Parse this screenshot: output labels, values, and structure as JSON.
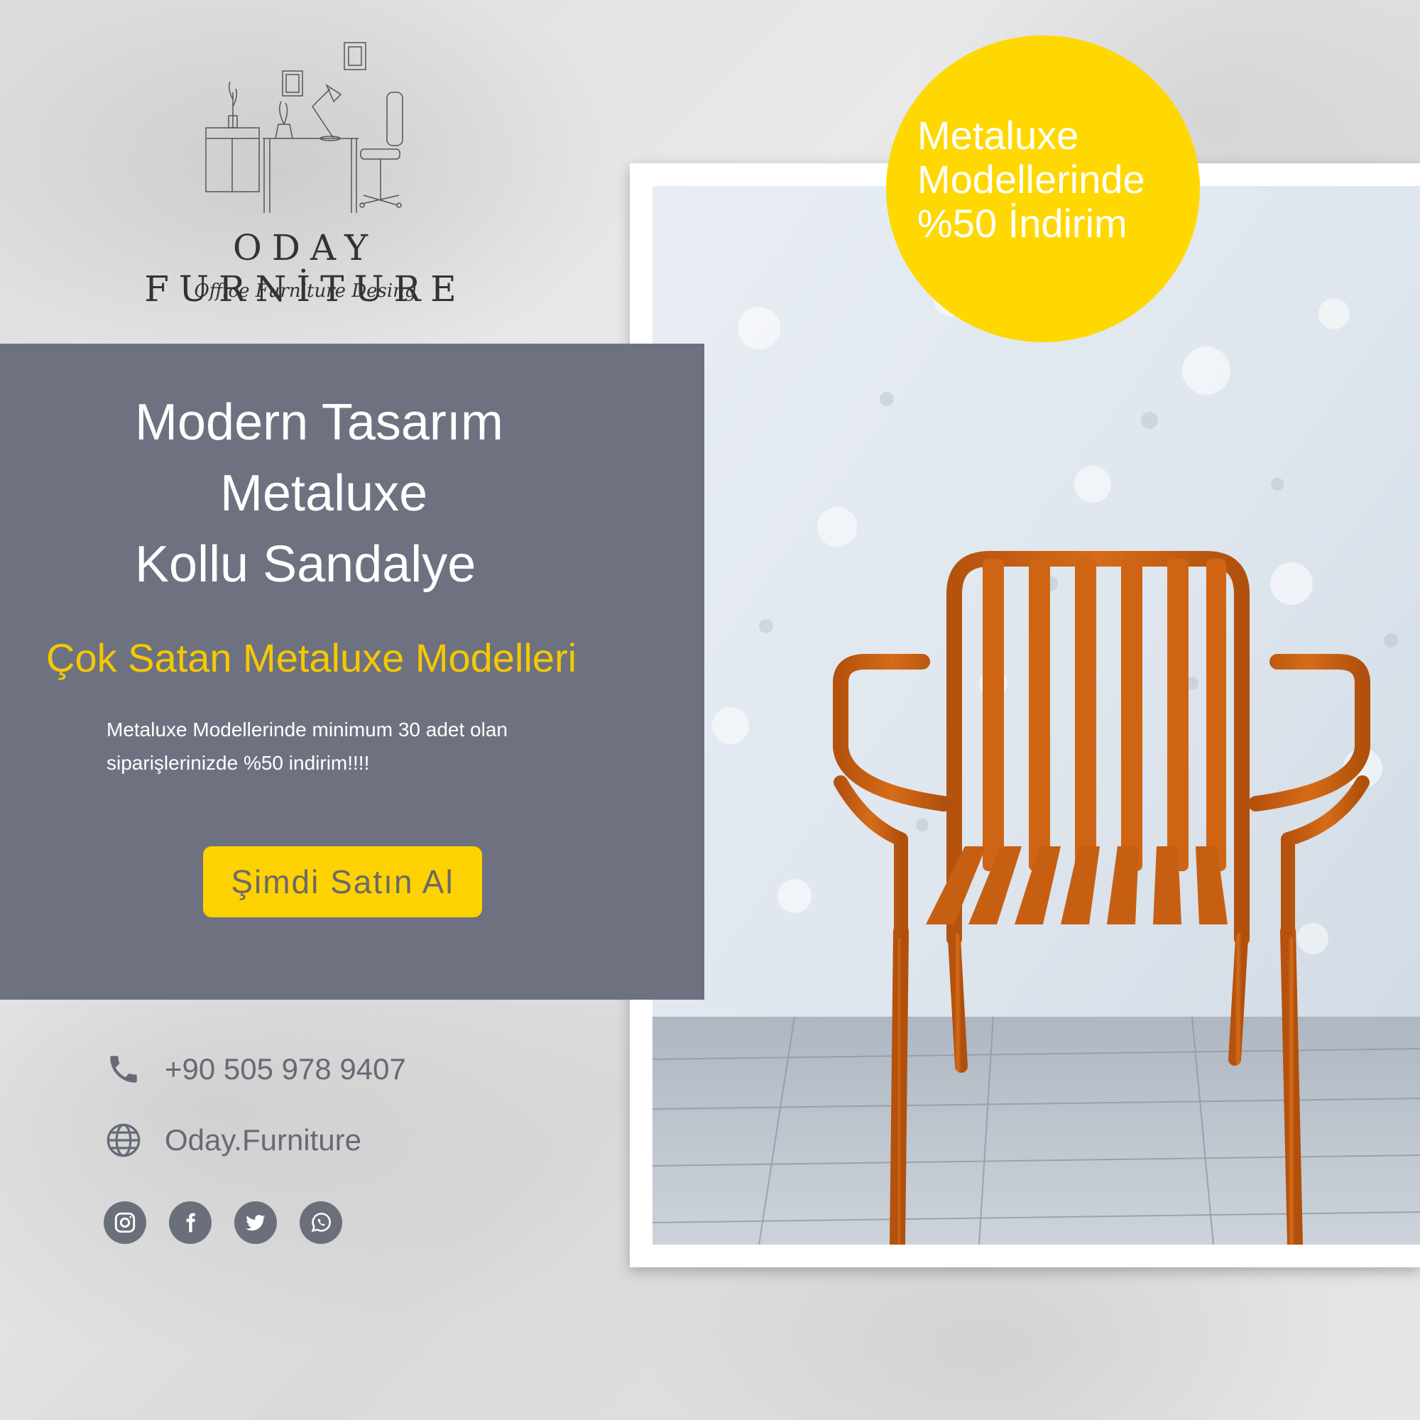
{
  "brand": {
    "name": "ODAY FURNİTURE",
    "tagline": "Office Furniture Desing"
  },
  "badge": {
    "line1": "Metaluxe",
    "line2": "Modellerinde",
    "line3": "%50 İndirim"
  },
  "panel": {
    "title_line1": "Modern Tasarım",
    "title_line2": "Metaluxe",
    "title_line3": "Kollu Sandalye",
    "subtitle": "Çok Satan Metaluxe Modelleri",
    "description_line1": "Metaluxe Modellerinde minimum 30 adet olan",
    "description_line2": "siparişlerinizde %50 indirim!!!!",
    "cta_label": "Şimdi Satın Al"
  },
  "contact": {
    "phone": "+90 505 978 9407",
    "website": "Oday.Furniture"
  },
  "social": [
    "instagram-icon",
    "facebook-icon",
    "twitter-icon",
    "whatsapp-icon"
  ],
  "colors": {
    "panel": "#6e7280",
    "accent_yellow": "#fed201",
    "subtitle_yellow": "#f5c800",
    "chair_orange": "#c65f12"
  }
}
